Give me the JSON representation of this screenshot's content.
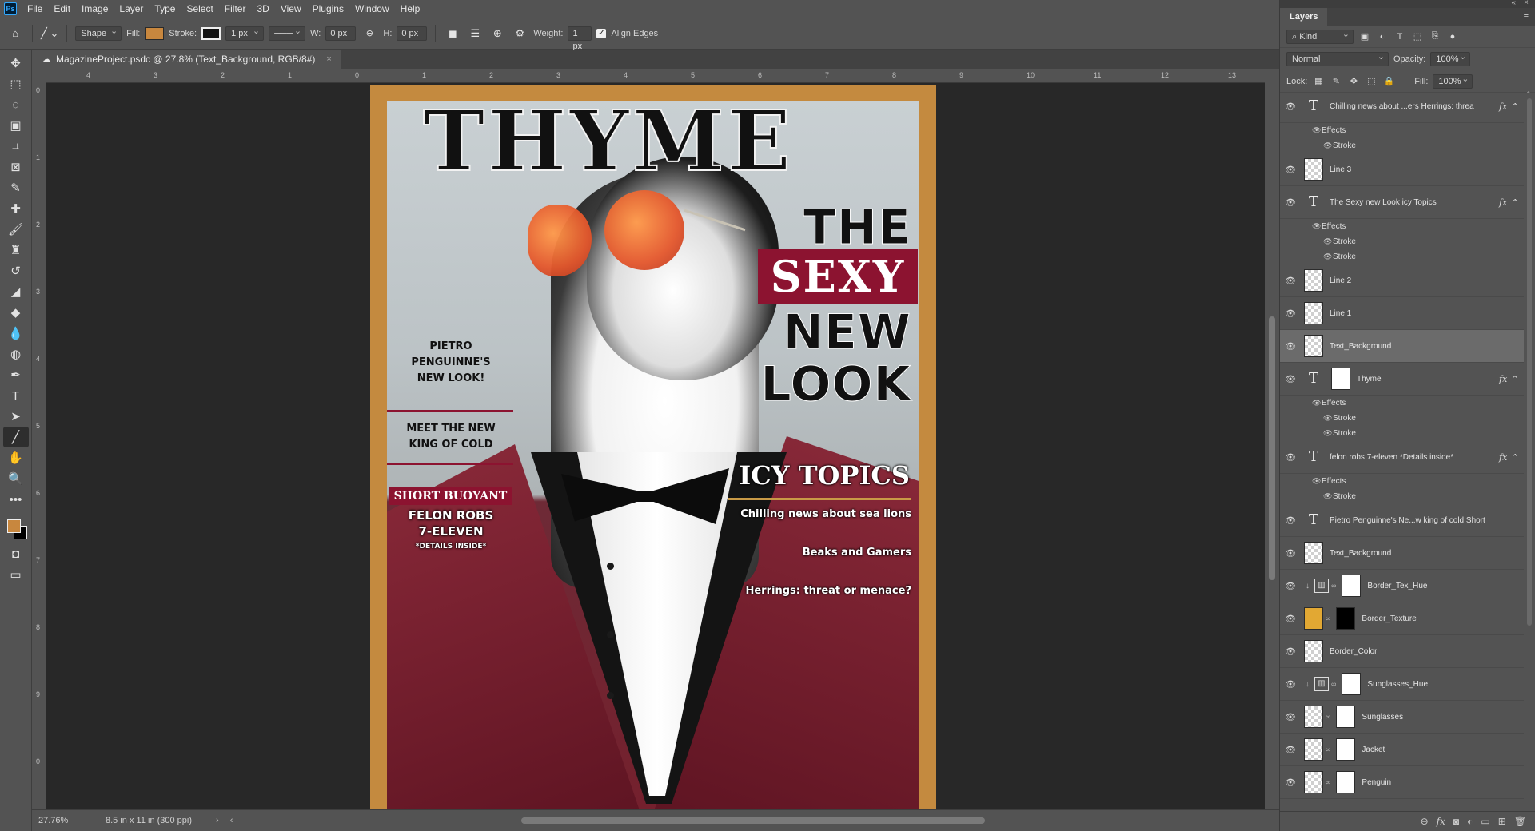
{
  "menu": [
    "File",
    "Edit",
    "Image",
    "Layer",
    "Type",
    "Select",
    "Filter",
    "3D",
    "View",
    "Plugins",
    "Window",
    "Help"
  ],
  "options": {
    "mode": "Shape",
    "fill_label": "Fill:",
    "stroke_label": "Stroke:",
    "stroke_width": "1 px",
    "w_label": "W:",
    "w_value": "0 px",
    "h_label": "H:",
    "h_value": "0 px",
    "weight_label": "Weight:",
    "weight_value": "1 px",
    "align_edges": "Align Edges",
    "fill_color": "#c8873e"
  },
  "document": {
    "tab_title": "MagazineProject.psdc @ 27.8% (Text_Background, RGB/8#)",
    "close": "×"
  },
  "rulers": {
    "top": [
      "4",
      "3",
      "2",
      "1",
      "0",
      "1",
      "2",
      "3",
      "4",
      "5",
      "6",
      "7",
      "8",
      "9",
      "10",
      "11",
      "12",
      "13"
    ],
    "left": [
      "0",
      "1",
      "2",
      "3",
      "4",
      "5",
      "6",
      "7",
      "8",
      "9",
      "0"
    ]
  },
  "status": {
    "zoom": "27.76%",
    "doc_info": "8.5 in x 11 in (300 ppi)"
  },
  "magazine": {
    "title": "THYME",
    "the": "THE",
    "sexy": "SEXY",
    "new": "NEW",
    "look": "LOOK",
    "pietro": [
      "PIETRO",
      "PENGUINNE'S",
      "NEW LOOK!"
    ],
    "meet": [
      "MEET THE NEW",
      "KING OF COLD"
    ],
    "short_buoyant": "SHORT BUOYANT",
    "felon": [
      "FELON ROBS",
      "7-ELEVEN"
    ],
    "details": "*DETAILS INSIDE*",
    "icy_topics": "ICY TOPICS",
    "topics": [
      "Chilling news about sea lions",
      "Beaks and Gamers",
      "Herrings: threat or menace?"
    ]
  },
  "layers_panel": {
    "tab": "Layers",
    "kind": "Kind",
    "blend_mode": "Normal",
    "opacity_label": "Opacity:",
    "opacity_value": "100%",
    "lock_label": "Lock:",
    "fill_label": "Fill:",
    "fill_value": "100%",
    "effects_label": "Effects",
    "stroke_label": "Stroke",
    "layers": [
      {
        "name": "Chilling news about ...ers  Herrings: threa",
        "kind": "text",
        "fx": true,
        "effects": [
          "Stroke"
        ]
      },
      {
        "name": "Line 3",
        "kind": "shape"
      },
      {
        "name": "The Sexy new Look  icy Topics",
        "kind": "text",
        "fx": true,
        "effects": [
          "Stroke",
          "Stroke"
        ]
      },
      {
        "name": "Line 2",
        "kind": "shape"
      },
      {
        "name": "Line 1",
        "kind": "shape"
      },
      {
        "name": "Text_Background",
        "kind": "raster",
        "selected": true
      },
      {
        "name": "Thyme",
        "kind": "text-masked",
        "fx": true,
        "effects": [
          "Stroke",
          "Stroke"
        ]
      },
      {
        "name": "felon robs 7-eleven *Details inside*",
        "kind": "text",
        "fx": true,
        "effects": [
          "Stroke"
        ]
      },
      {
        "name": "Pietro Penguinne's Ne...w king of cold  Short",
        "kind": "text"
      },
      {
        "name": "Text_Background",
        "kind": "raster"
      },
      {
        "name": "Border_Tex_Hue",
        "kind": "adjustment"
      },
      {
        "name": "Border_Texture",
        "kind": "gold-mask"
      },
      {
        "name": "Border_Color",
        "kind": "raster"
      },
      {
        "name": "Sunglasses_Hue",
        "kind": "adjustment"
      },
      {
        "name": "Sunglasses",
        "kind": "masked"
      },
      {
        "name": "Jacket",
        "kind": "masked"
      },
      {
        "name": "Penguin",
        "kind": "masked"
      }
    ]
  }
}
